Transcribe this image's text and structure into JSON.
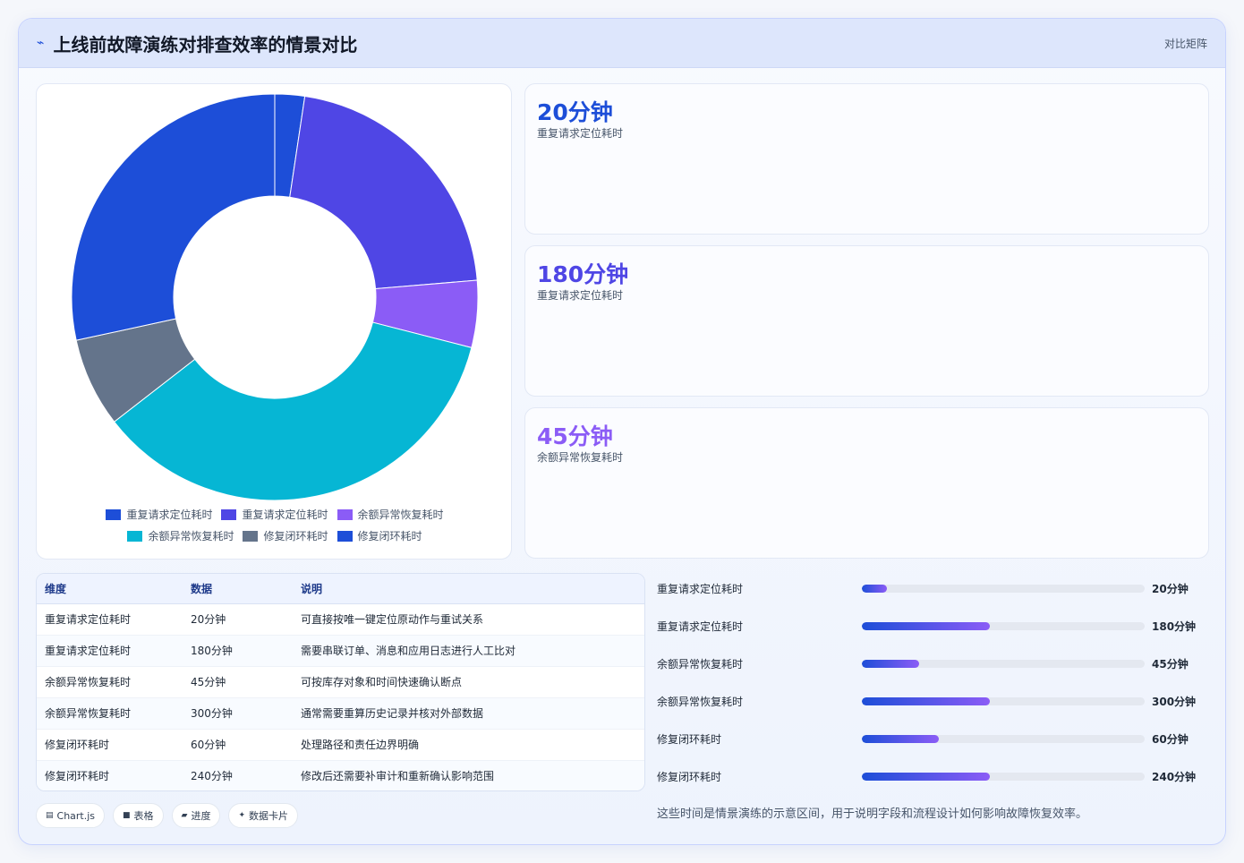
{
  "header": {
    "title": "上线前故障演练对排查效率的情景对比",
    "link": "对比矩阵"
  },
  "chart_data": {
    "type": "pie",
    "donut": true,
    "categories": [
      "重复请求定位耗时",
      "重复请求定位耗时",
      "余额异常恢复耗时",
      "余额异常恢复耗时",
      "修复闭环耗时",
      "修复闭环耗时"
    ],
    "values": [
      20,
      180,
      45,
      300,
      60,
      240
    ],
    "colors": [
      "#1d4ed8",
      "#4f46e5",
      "#8b5cf6",
      "#06b6d4",
      "#64748b",
      "#1d4ed8"
    ],
    "legend_position": "bottom"
  },
  "stats": [
    {
      "value": "20分钟",
      "label": "重复请求定位耗时",
      "color": "#1d4ed8"
    },
    {
      "value": "180分钟",
      "label": "重复请求定位耗时",
      "color": "#4f46e5"
    },
    {
      "value": "45分钟",
      "label": "余额异常恢复耗时",
      "color": "#8b5cf6"
    }
  ],
  "table": {
    "headers": [
      "维度",
      "数据",
      "说明"
    ],
    "rows": [
      [
        "重复请求定位耗时",
        "20分钟",
        "可直接按唯一键定位原动作与重试关系"
      ],
      [
        "重复请求定位耗时",
        "180分钟",
        "需要串联订单、消息和应用日志进行人工比对"
      ],
      [
        "余额异常恢复耗时",
        "45分钟",
        "可按库存对象和时间快速确认断点"
      ],
      [
        "余额异常恢复耗时",
        "300分钟",
        "通常需要重算历史记录并核对外部数据"
      ],
      [
        "修复闭环耗时",
        "60分钟",
        "处理路径和责任边界明确"
      ],
      [
        "修复闭环耗时",
        "240分钟",
        "修改后还需要补审计和重新确认影响范围"
      ]
    ]
  },
  "progress": [
    {
      "label": "重复请求定位耗时",
      "value": "20分钟",
      "fraction": 0.089
    },
    {
      "label": "重复请求定位耗时",
      "value": "180分钟",
      "fraction": 0.453
    },
    {
      "label": "余额异常恢复耗时",
      "value": "45分钟",
      "fraction": 0.203
    },
    {
      "label": "余额异常恢复耗时",
      "value": "300分钟",
      "fraction": 0.453
    },
    {
      "label": "修复闭环耗时",
      "value": "60分钟",
      "fraction": 0.272
    },
    {
      "label": "修复闭环耗时",
      "value": "240分钟",
      "fraction": 0.453
    }
  ],
  "note": "这些时间是情景演练的示意区间，用于说明字段和流程设计如何影响故障恢复效率。",
  "chips": [
    {
      "icon": "chart-icon",
      "glyph": "▤",
      "label": "Chart.js"
    },
    {
      "icon": "table-icon",
      "glyph": "■",
      "label": "表格"
    },
    {
      "icon": "progress-icon",
      "glyph": "▰",
      "label": "进度"
    },
    {
      "icon": "card-icon",
      "glyph": "✦",
      "label": "数据卡片"
    }
  ]
}
